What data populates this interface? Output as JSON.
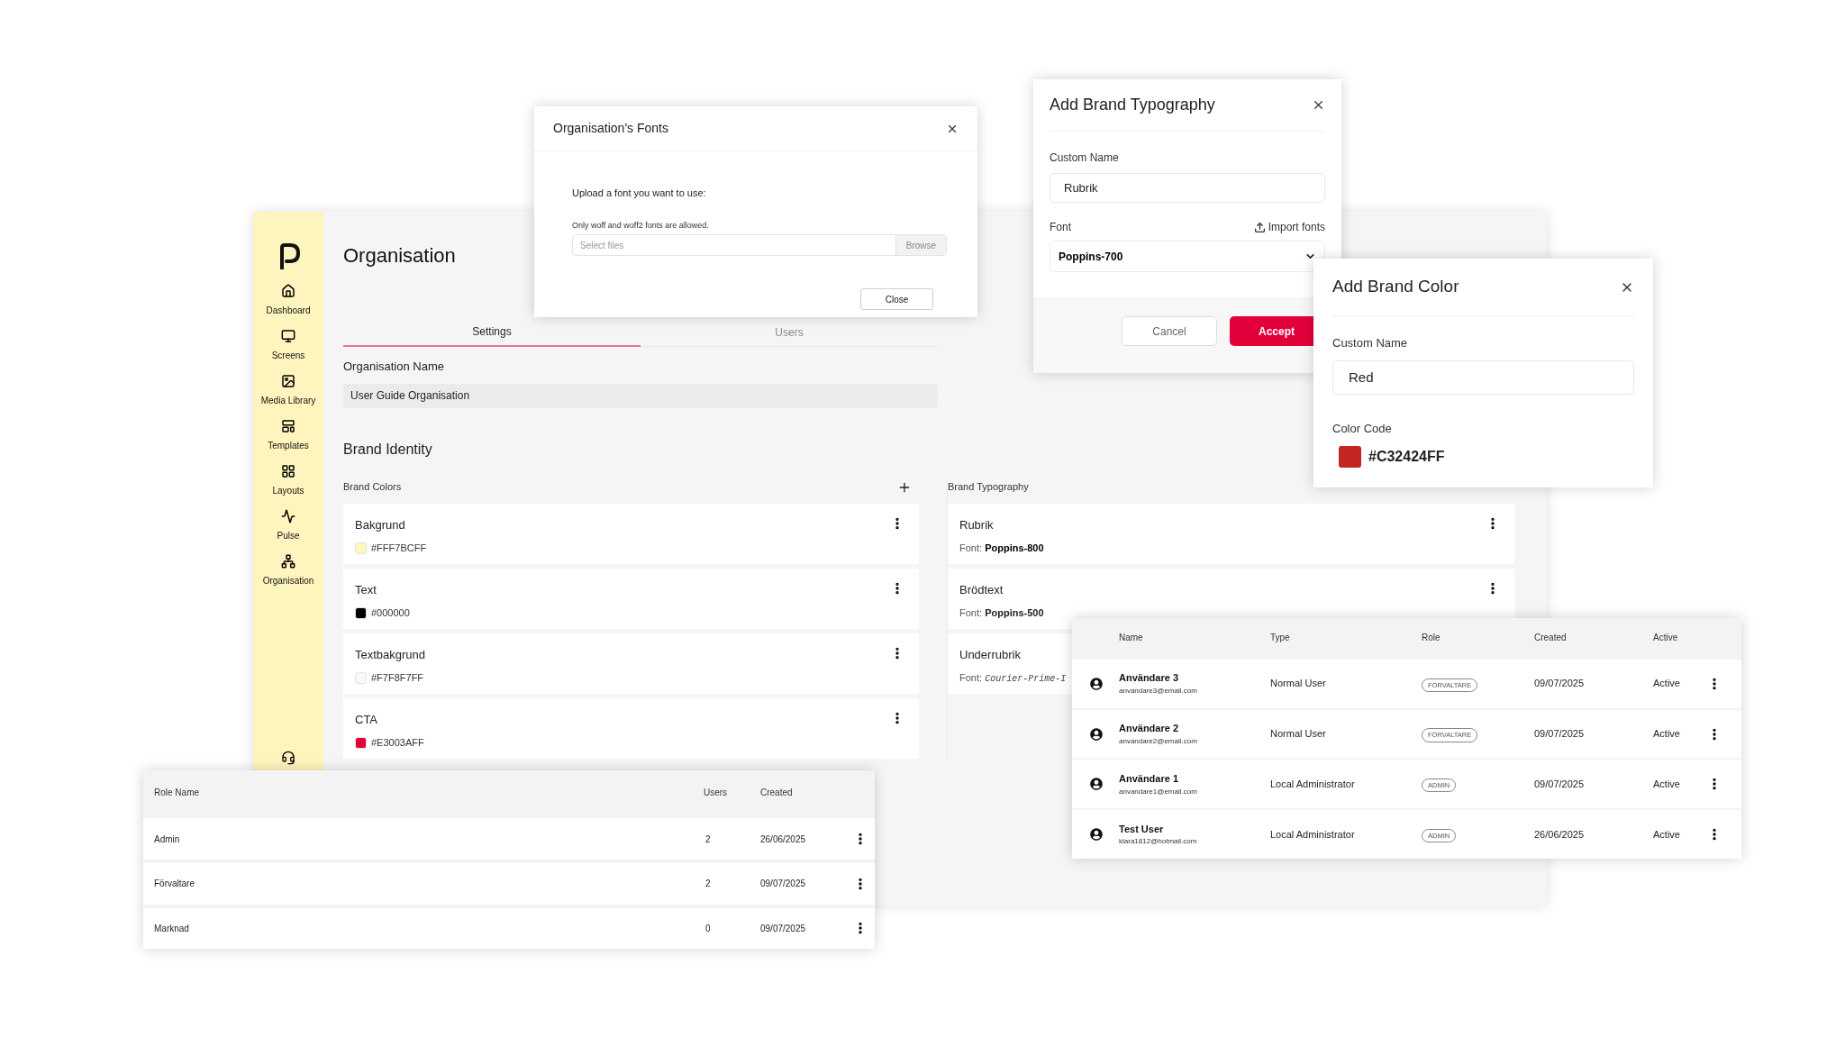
{
  "main_window": {
    "sidebar": {
      "items": [
        {
          "label": "Dashboard"
        },
        {
          "label": "Screens"
        },
        {
          "label": "Media Library"
        },
        {
          "label": "Templates"
        },
        {
          "label": "Layouts"
        },
        {
          "label": "Pulse"
        },
        {
          "label": "Organisation"
        }
      ]
    },
    "title": "Organisation",
    "tabs": [
      {
        "label": "Settings",
        "selected": true
      },
      {
        "label": "Users",
        "selected": false
      }
    ],
    "organisation_name": {
      "label": "Organisation Name",
      "value": "User Guide Organisation"
    },
    "brand_identity": {
      "heading": "Brand Identity",
      "brand_colors": {
        "label": "Brand Colors",
        "items": [
          {
            "name": "Bakgrund",
            "code": "#FFF7BCFF",
            "color": "#fff7bc"
          },
          {
            "name": "Text",
            "code": "#000000",
            "color": "#000000"
          },
          {
            "name": "Textbakgrund",
            "code": "#F7F8F7FF",
            "color": "#f7f8f7"
          },
          {
            "name": "CTA",
            "code": "#E3003AFF",
            "color": "#e3003a"
          }
        ]
      },
      "brand_typography": {
        "label": "Brand Typography",
        "items": [
          {
            "name": "Rubrik",
            "font_label": "Font:",
            "font": "Poppins-800",
            "kind": "bold"
          },
          {
            "name": "Brödtext",
            "font_label": "Font:",
            "font": "Poppins-500",
            "kind": "medium"
          },
          {
            "name": "Underrubrik",
            "font_label": "Font:",
            "font": "Courier-Prime-I",
            "kind": "mono"
          }
        ]
      }
    }
  },
  "fonts_dialog": {
    "title": "Organisation's Fonts",
    "prompt": "Upload a font you want to use:",
    "hint": "Only woff and woff2 fonts are allowed.",
    "file_field": {
      "placeholder": "Select files",
      "button": "Browse"
    },
    "close_button": "Close"
  },
  "typography_dialog": {
    "title": "Add Brand Typography",
    "custom_name_label": "Custom Name",
    "custom_name": "Rubrik",
    "font_label": "Font",
    "import_button": "Import fonts",
    "font_value": "Poppins-700",
    "cancel_button": "Cancel",
    "accept_button": "Accept"
  },
  "color_dialog": {
    "title": "Add Brand Color",
    "custom_name_label": "Custom Name",
    "custom_name": "Red",
    "color_code_label": "Color Code",
    "color_code": "#C32424FF",
    "color": "#c32424"
  },
  "users_table": {
    "columns": [
      "Name",
      "Type",
      "Role",
      "Created",
      "Active"
    ],
    "rows": [
      {
        "name": "Användare 3",
        "email": "anvandare3@email.com",
        "type": "Normal User",
        "role": "FÖRVALTARE",
        "created": "09/07/2025",
        "active": "Active"
      },
      {
        "name": "Användare 2",
        "email": "anvandare2@email.com",
        "type": "Normal User",
        "role": "FÖRVALTARE",
        "created": "09/07/2025",
        "active": "Active"
      },
      {
        "name": "Användare 1",
        "email": "anvandare1@email.com",
        "type": "Local Administrator",
        "role": "ADMIN",
        "created": "09/07/2025",
        "active": "Active"
      },
      {
        "name": "Test User",
        "email": "klara1812@hotmail.com",
        "type": "Local Administrator",
        "role": "ADMIN",
        "created": "26/06/2025",
        "active": "Active"
      }
    ]
  },
  "roles_table": {
    "columns": [
      "Role Name",
      "Users",
      "Created"
    ],
    "rows": [
      {
        "name": "Admin",
        "users": "2",
        "created": "26/06/2025"
      },
      {
        "name": "Förvaltare",
        "users": "2",
        "created": "09/07/2025"
      },
      {
        "name": "Marknad",
        "users": "0",
        "created": "09/07/2025"
      }
    ]
  }
}
